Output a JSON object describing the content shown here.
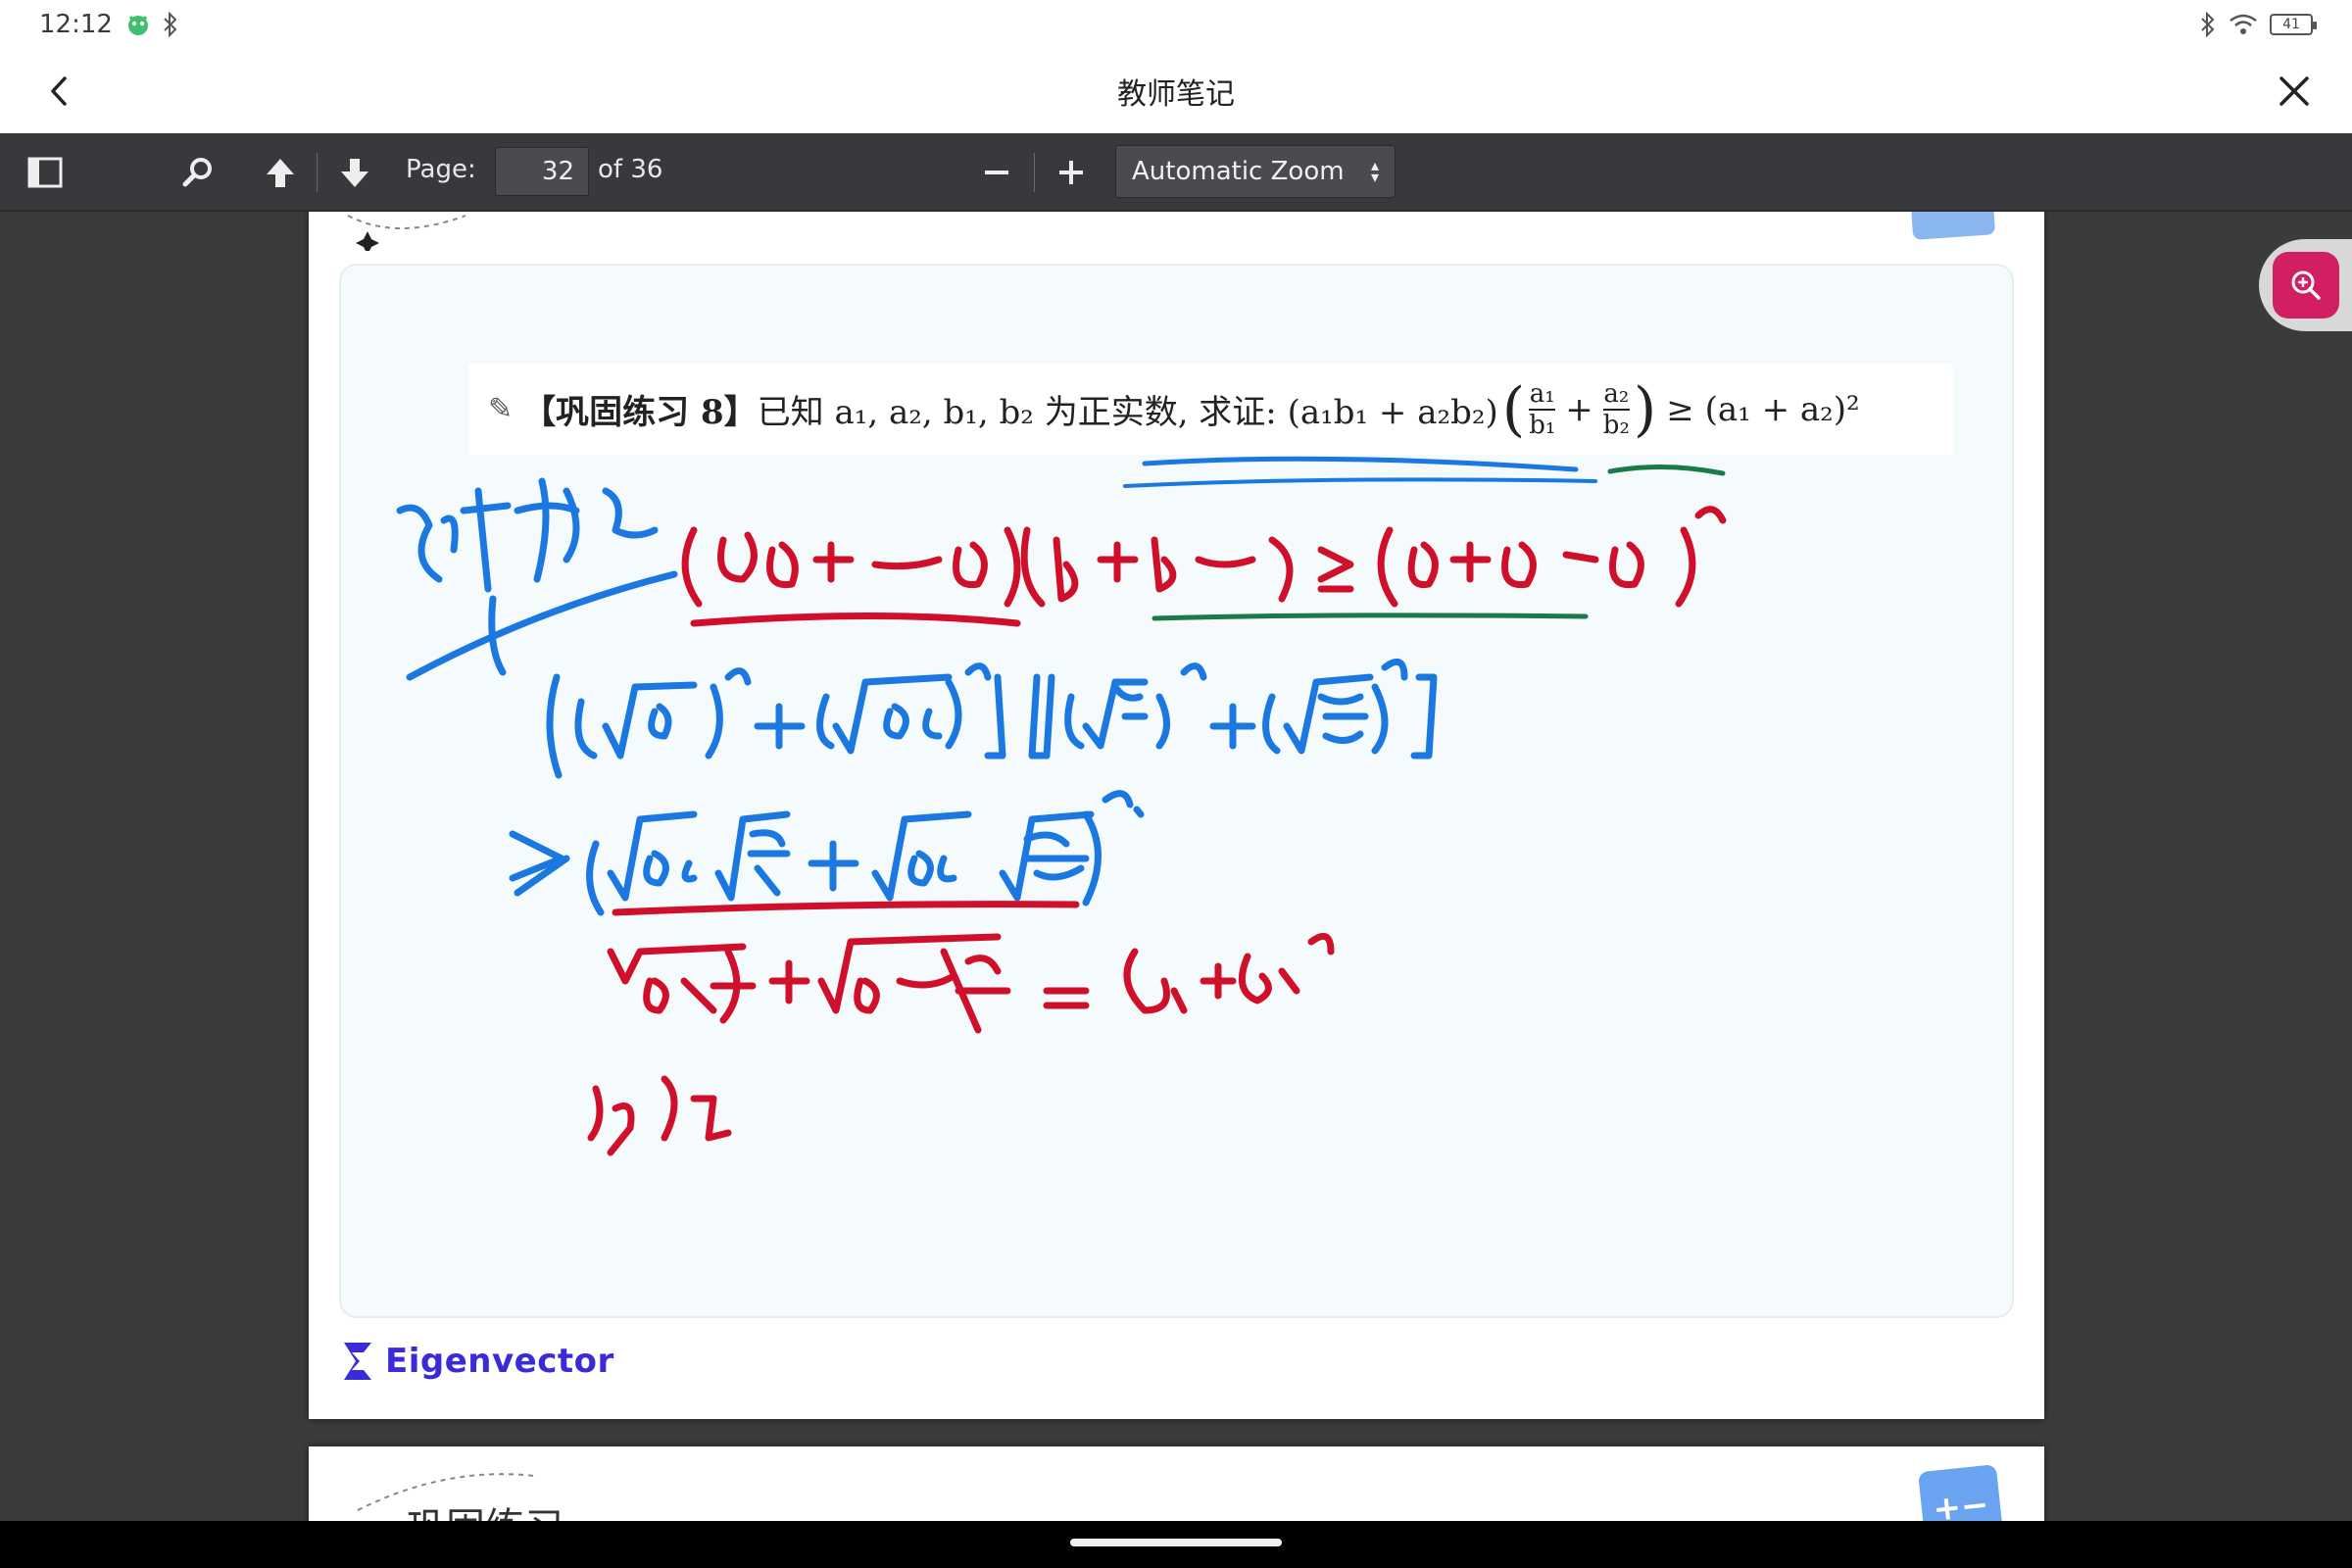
{
  "status_bar": {
    "time": "12:12",
    "battery": "41"
  },
  "app_bar": {
    "title": "教师笔记"
  },
  "toolbar": {
    "page_label": "Page:",
    "page_value": "32",
    "page_of": "of 36",
    "zoom_selected": "Automatic Zoom"
  },
  "document": {
    "problem_tag": "【巩固练习 8】",
    "problem_text": "已知 a₁, a₂, b₁, b₂ 为正实数, 求证: (a₁b₁ + a₂b₂)",
    "frac1_num": "a₁",
    "frac1_den": "b₁",
    "frac2_num": "a₂",
    "frac2_den": "b₂",
    "problem_rhs": "≥ (a₁ + a₂)²",
    "brand": "Eigenvector",
    "next_section_title": "巩固练习"
  },
  "colors": {
    "accent_red": "#d0102a",
    "ink_blue": "#1a78e0",
    "ink_green": "#1a7a4a",
    "brand": "#3a2ad8"
  }
}
